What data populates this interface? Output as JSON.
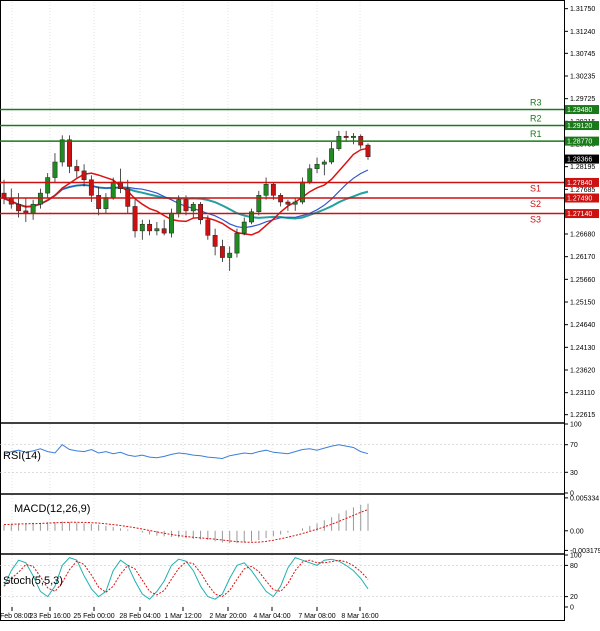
{
  "colors": {
    "frame": "#000000",
    "grid": "#c8c8c8",
    "bull_candle": "#1e8c1e",
    "bear_candle": "#cc1111",
    "resistance": "#1a7a1a",
    "support": "#cc1111",
    "ma_fast": "#dd1111",
    "ma_mid": "#3355cc",
    "ma_slow": "#22a0a0",
    "rsi_line": "#3b7fd9",
    "macd_hist": "#999999",
    "macd_signal": "#dd1111",
    "stoch_main": "#22b0b0",
    "stoch_signal": "#dd1111",
    "price_badge_bg": "#000000",
    "price_badge_fg": "#ffffff"
  },
  "chart_data": [
    {
      "type": "candlestick",
      "title": "",
      "ylim": [
        1.2245,
        1.319
      ],
      "y_ticks": [
        "1.31750",
        "1.31240",
        "1.30745",
        "1.30235",
        "1.29725",
        "1.29215",
        "1.28705",
        "1.28195",
        "1.27685",
        "1.27175",
        "1.26680",
        "1.26170",
        "1.25660",
        "1.25150",
        "1.24640",
        "1.24130",
        "1.23620",
        "1.23110",
        "1.22615"
      ],
      "x_ticks": [
        "Feb 08:00",
        "23 Feb 16:00",
        "25 Feb 00:00",
        "28 Feb 04:00",
        "1 Mar 12:00",
        "2 Mar 20:00",
        "4 Mar 04:00",
        "7 Mar 08:00",
        "8 Mar 16:00"
      ],
      "candles": [
        [
          1.276,
          1.279,
          1.2735,
          1.2748
        ],
        [
          1.2748,
          1.277,
          1.2725,
          1.2735
        ],
        [
          1.2735,
          1.276,
          1.2705,
          1.272
        ],
        [
          1.272,
          1.275,
          1.2695,
          1.2715
        ],
        [
          1.2715,
          1.2745,
          1.27,
          1.2735
        ],
        [
          1.2735,
          1.277,
          1.2725,
          1.276
        ],
        [
          1.276,
          1.2805,
          1.275,
          1.2795
        ],
        [
          1.2795,
          1.285,
          1.2785,
          1.283
        ],
        [
          1.283,
          1.289,
          1.282,
          1.288
        ],
        [
          1.288,
          1.289,
          1.2805,
          1.282
        ],
        [
          1.282,
          1.2835,
          1.2795,
          1.281
        ],
        [
          1.281,
          1.2825,
          1.2775,
          1.279
        ],
        [
          1.279,
          1.28,
          1.274,
          1.2755
        ],
        [
          1.2755,
          1.2775,
          1.271,
          1.2725
        ],
        [
          1.2725,
          1.276,
          1.2715,
          1.275
        ],
        [
          1.275,
          1.2795,
          1.2745,
          1.2785
        ],
        [
          1.2785,
          1.2815,
          1.276,
          1.277
        ],
        [
          1.277,
          1.279,
          1.2715,
          1.273
        ],
        [
          1.273,
          1.2745,
          1.266,
          1.2675
        ],
        [
          1.2675,
          1.27,
          1.2655,
          1.269
        ],
        [
          1.269,
          1.27,
          1.2665,
          1.2675
        ],
        [
          1.2675,
          1.2695,
          1.2665,
          1.268
        ],
        [
          1.268,
          1.27,
          1.2665,
          1.267
        ],
        [
          1.267,
          1.2725,
          1.266,
          1.2715
        ],
        [
          1.2715,
          1.2755,
          1.2705,
          1.2745
        ],
        [
          1.2745,
          1.2755,
          1.271,
          1.272
        ],
        [
          1.272,
          1.274,
          1.2705,
          1.2735
        ],
        [
          1.2735,
          1.274,
          1.269,
          1.27
        ],
        [
          1.27,
          1.271,
          1.2655,
          1.2665
        ],
        [
          1.2665,
          1.268,
          1.262,
          1.264
        ],
        [
          1.264,
          1.2655,
          1.2605,
          1.2615
        ],
        [
          1.2615,
          1.264,
          1.2585,
          1.2625
        ],
        [
          1.2625,
          1.268,
          1.2615,
          1.267
        ],
        [
          1.267,
          1.2705,
          1.2665,
          1.2695
        ],
        [
          1.2695,
          1.2725,
          1.269,
          1.2718
        ],
        [
          1.2718,
          1.2765,
          1.271,
          1.2755
        ],
        [
          1.2755,
          1.2795,
          1.2745,
          1.278
        ],
        [
          1.278,
          1.2785,
          1.2745,
          1.2755
        ],
        [
          1.2755,
          1.276,
          1.273,
          1.274
        ],
        [
          1.274,
          1.2745,
          1.272,
          1.2735
        ],
        [
          1.2735,
          1.2748,
          1.272,
          1.274
        ],
        [
          1.274,
          1.2795,
          1.2735,
          1.2785
        ],
        [
          1.2785,
          1.2825,
          1.278,
          1.2815
        ],
        [
          1.2815,
          1.284,
          1.2805,
          1.2825
        ],
        [
          1.2825,
          1.2835,
          1.28,
          1.283
        ],
        [
          1.283,
          1.2875,
          1.2825,
          1.286
        ],
        [
          1.286,
          1.29,
          1.2855,
          1.2888
        ],
        [
          1.2888,
          1.29,
          1.2875,
          1.2885
        ],
        [
          1.2885,
          1.2895,
          1.287,
          1.2888
        ],
        [
          1.2888,
          1.2892,
          1.286,
          1.2868
        ],
        [
          1.2868,
          1.2872,
          1.2835,
          1.2842
        ]
      ],
      "series": [],
      "levels": [
        {
          "name": "R3",
          "value": 1.2948,
          "label": "1.29480"
        },
        {
          "name": "R2",
          "value": 1.2912,
          "label": "1.29120"
        },
        {
          "name": "R1",
          "value": 1.2877,
          "label": "1.28770"
        },
        {
          "name": "S1",
          "value": 1.2784,
          "label": "1.27840"
        },
        {
          "name": "S2",
          "value": 1.2749,
          "label": "1.27490"
        },
        {
          "name": "S3",
          "value": 1.2714,
          "label": "1.27140"
        }
      ],
      "current_price": {
        "value": 1.28366,
        "label": "1.28366"
      }
    },
    {
      "type": "line",
      "title": "RSI(14)",
      "ylim": [
        0,
        100
      ],
      "y_ticks": [
        "100",
        "70",
        "30",
        "0"
      ],
      "series": [
        {
          "name": "RSI(14)",
          "values": [
            56,
            60,
            62,
            59,
            61,
            64,
            60,
            58,
            70,
            63,
            61,
            60,
            63,
            58,
            60,
            57,
            59,
            55,
            53,
            55,
            52,
            51,
            53,
            56,
            58,
            57,
            55,
            54,
            52,
            51,
            50,
            54,
            56,
            58,
            57,
            60,
            62,
            59,
            58,
            57,
            60,
            63,
            64,
            62,
            65,
            68,
            70,
            68,
            66,
            60,
            57
          ]
        }
      ]
    },
    {
      "type": "line",
      "title": "MACD(12,26,9)",
      "ylim": [
        -0.0036,
        0.0058
      ],
      "y_ticks": [
        "0.005334",
        "0.00",
        "-0.003179"
      ],
      "series": [
        {
          "name": "MACD(12,26,9)",
          "values": [
            0.001,
            0.0011,
            0.0012,
            0.0012,
            0.0013,
            0.0013,
            0.0014,
            0.0014,
            0.0015,
            0.0014,
            0.0013,
            0.0012,
            0.0011,
            0.001,
            0.0008,
            0.0006,
            0.0004,
            0.0002,
            0.0,
            -0.0003,
            -0.0006,
            -0.0008,
            -0.0009,
            -0.001,
            -0.0011,
            -0.0012,
            -0.0013,
            -0.0014,
            -0.0015,
            -0.0017,
            -0.0019,
            -0.002,
            -0.002,
            -0.0019,
            -0.0017,
            -0.0015,
            -0.0012,
            -0.0009,
            -0.0006,
            -0.0003,
            0.0,
            0.0004,
            0.0008,
            0.0012,
            0.0017,
            0.0022,
            0.0028,
            0.0033,
            0.0038,
            0.0042,
            0.0044
          ]
        }
      ]
    },
    {
      "type": "line",
      "title": "Stoch(5,5,3)",
      "ylim": [
        0,
        100
      ],
      "y_ticks": [
        "100",
        "80",
        "20",
        "0"
      ],
      "series": [
        {
          "name": "Stoch(5,5,3)",
          "values": [
            40,
            70,
            90,
            85,
            60,
            30,
            20,
            40,
            80,
            95,
            90,
            60,
            35,
            20,
            30,
            70,
            90,
            80,
            50,
            25,
            15,
            30,
            50,
            80,
            92,
            88,
            70,
            40,
            20,
            15,
            25,
            55,
            80,
            85,
            70,
            50,
            30,
            20,
            40,
            75,
            95,
            90,
            85,
            80,
            90,
            92,
            88,
            80,
            70,
            55,
            35
          ]
        }
      ]
    }
  ]
}
